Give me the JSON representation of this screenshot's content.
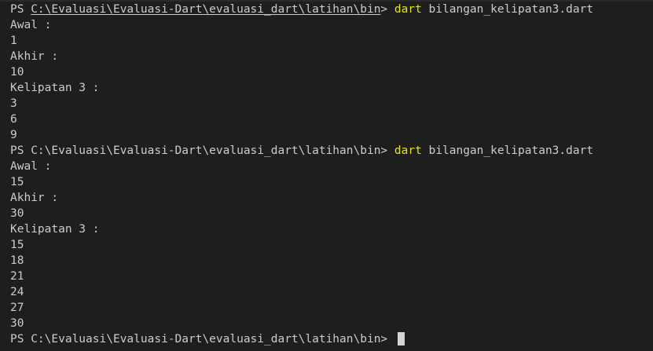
{
  "terminal": {
    "prompt_prefix": "PS ",
    "prompt_path": "C:\\Evaluasi\\Evaluasi-Dart\\evaluasi_dart\\latihan\\bin",
    "prompt_suffix": "> ",
    "runs": [
      {
        "command": "dart",
        "argument": " bilangan_kelipatan3.dart",
        "output": [
          "Awal :",
          "1",
          "Akhir :",
          "10",
          "Kelipatan 3 :",
          "3",
          "6",
          "9"
        ]
      },
      {
        "command": "dart",
        "argument": " bilangan_kelipatan3.dart",
        "output": [
          "Awal :",
          "15",
          "Akhir :",
          "30",
          "Kelipatan 3 :",
          "15",
          "18",
          "21",
          "24",
          "27",
          "30"
        ]
      }
    ]
  },
  "colors": {
    "background": "#1e1e1e",
    "text": "#cccccc",
    "command": "#e5e510"
  }
}
